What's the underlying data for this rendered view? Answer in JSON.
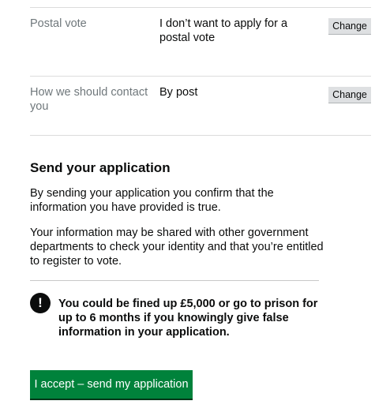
{
  "summary": {
    "rows": [
      {
        "key": "Postal vote",
        "value": "I don’t want to apply for a postal vote",
        "action": "Change"
      },
      {
        "key": "How we should contact you",
        "value": "By post",
        "action": "Change"
      }
    ]
  },
  "send": {
    "heading": "Send your application",
    "confirm_text": "By sending your application you confirm that the information you have provided is true.",
    "share_text": "Your information may be shared with other government departments to check your identity and that you’re entitled to register to vote.",
    "warning_icon": "!",
    "warning_text": "You could be fined up £5,000 or go to prison for up to 6 months if you knowingly give false information in your application.",
    "submit_label": "I accept – send my application"
  }
}
